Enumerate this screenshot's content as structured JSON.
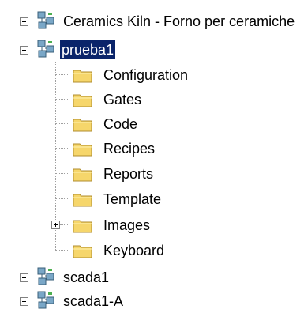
{
  "tree": {
    "root_items": [
      {
        "label": "Ceramics Kiln - Forno per ceramiche",
        "expanded": false
      },
      {
        "label": "prueba1",
        "expanded": true,
        "selected": true,
        "children": [
          {
            "label": "Configuration"
          },
          {
            "label": "Gates"
          },
          {
            "label": "Code"
          },
          {
            "label": "Recipes"
          },
          {
            "label": "Reports"
          },
          {
            "label": "Template"
          },
          {
            "label": "Images",
            "has_children": true
          },
          {
            "label": "Keyboard"
          }
        ]
      },
      {
        "label": "scada1",
        "expanded": false
      },
      {
        "label": "scada1-A",
        "expanded": false
      }
    ]
  },
  "colors": {
    "selection": "#0a246a",
    "folder": "#f6d66b",
    "folder_edge": "#b08d2f"
  },
  "icons": {
    "project": "network-project-icon",
    "folder": "folder-icon"
  }
}
